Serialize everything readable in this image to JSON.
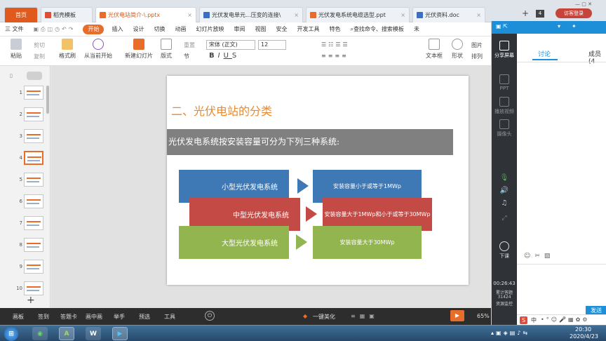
{
  "tabs": {
    "home": "首页",
    "t1": "稻壳模板",
    "t2": "光伏电站简介-\\.pptx",
    "t3": "光伏发电单元...压变的连接\\",
    "t4": "光伏发电系统电缆选型.ppt",
    "t5": "光伏资料.doc",
    "close": "×",
    "add": "+",
    "count": "4",
    "login": "访客登录"
  },
  "menu": {
    "file": "三 文件",
    "items": [
      "开始",
      "插入",
      "设计",
      "切换",
      "动画",
      "幻灯片放映",
      "审阅",
      "视图",
      "安全",
      "开发工具",
      "特色"
    ],
    "search": "查找命令、搜索模板",
    "sync": "未"
  },
  "ribbon": {
    "paste": "粘贴",
    "cut": "剪切",
    "copy": "复制",
    "format_painter": "格式刷",
    "from_start": "从当前开始",
    "new_slide": "新建幻灯片",
    "layout": "版式",
    "section": "节",
    "reset": "重置",
    "font_name": "宋体 (正文)",
    "font_size": "12",
    "textbox": "文本框",
    "shape": "形状",
    "arrange": "排列",
    "picture": "图片"
  },
  "thumbnails": [
    "1",
    "2",
    "3",
    "4",
    "5",
    "6",
    "7",
    "8",
    "9",
    "10"
  ],
  "slide": {
    "title": "二、光伏电站的分类",
    "subtitle": "光伏发电系统按安装容量可分为下列三种系统:",
    "rows": [
      {
        "label": "小型光伏发电系统",
        "desc": "安装容量小于或等于1MWp",
        "color": "#3e78b5"
      },
      {
        "label": "中型光伏发电系统",
        "desc": "安装容量大于1MWp和小于或等于30MWp",
        "color": "#c44b45"
      },
      {
        "label": "大型光伏发电系统",
        "desc": "安装容量大于30MWp",
        "color": "#93b54f"
      }
    ]
  },
  "statusbar": {
    "items": [
      "画板",
      "签到",
      "答题卡",
      "画中画",
      "举手",
      "预选",
      "工具"
    ],
    "beautify": "一键美化",
    "zoom": "65%"
  },
  "rightpanel": {
    "tab_discuss": "讨论",
    "tab_members": "成员(4",
    "share": "分享屏幕",
    "ppt": "PPT",
    "video": "播放视频",
    "camera": "摄像头",
    "end": "下课",
    "timer": "00:26:43",
    "gift_label": "累计答题",
    "gift_count": "31424",
    "resource": "资源监控",
    "send": "发送"
  },
  "taskbar": {
    "ime": "中",
    "time": "20:30",
    "date": "2020/4/23"
  }
}
